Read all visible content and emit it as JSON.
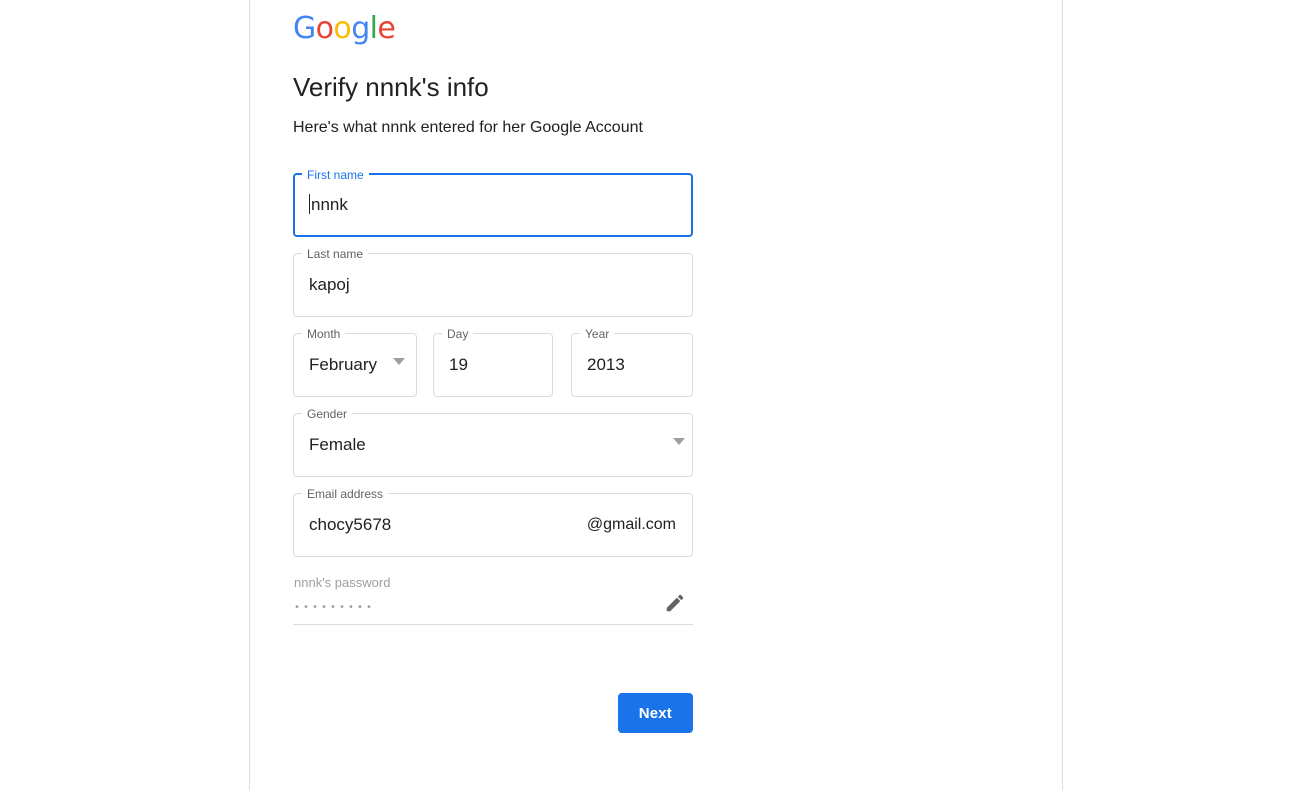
{
  "brand": {
    "logo_letters": [
      {
        "char": "G",
        "color": "#4285f4"
      },
      {
        "char": "o",
        "color": "#ea4335"
      },
      {
        "char": "o",
        "color": "#fbbc05"
      },
      {
        "char": "g",
        "color": "#4285f4"
      },
      {
        "char": "l",
        "color": "#34a853"
      },
      {
        "char": "e",
        "color": "#ea4335"
      }
    ]
  },
  "header": {
    "title": "Verify nnnk's info",
    "subtitle": "Here's what nnnk entered for her Google Account"
  },
  "form": {
    "first_name": {
      "label": "First name",
      "value": "nnnk",
      "focused": true
    },
    "last_name": {
      "label": "Last name",
      "value": "kapoj"
    },
    "birthday": {
      "month": {
        "label": "Month",
        "value": "February"
      },
      "day": {
        "label": "Day",
        "value": "19"
      },
      "year": {
        "label": "Year",
        "value": "2013"
      }
    },
    "gender": {
      "label": "Gender",
      "value": "Female"
    },
    "email": {
      "label": "Email address",
      "value": "chocy5678",
      "suffix": "@gmail.com"
    },
    "password": {
      "label": "nnnk's password",
      "masked_value": "•••••••••",
      "edit_icon": "pencil-edit-icon"
    }
  },
  "actions": {
    "next_label": "Next"
  },
  "colors": {
    "accent": "#1a73e8",
    "border": "#dadce0",
    "label": "#5f6368",
    "text": "#202124",
    "muted": "#9aa0a6"
  }
}
